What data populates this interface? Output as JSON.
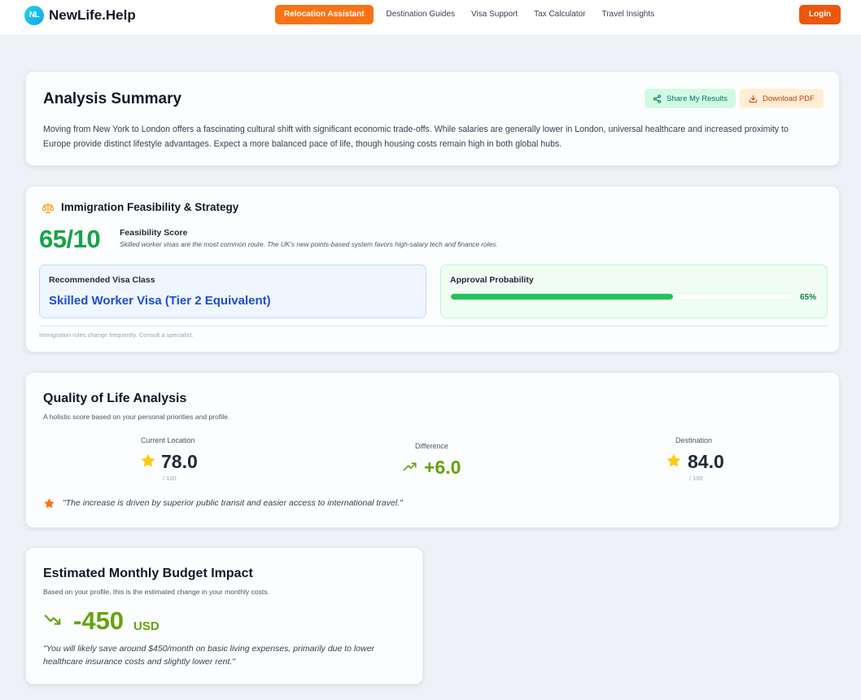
{
  "header": {
    "logo_badge": "NL",
    "brand": "NewLife.Help",
    "nav": [
      {
        "label": "Relocation Assistant",
        "active": true
      },
      {
        "label": "Destination Guides",
        "active": false
      },
      {
        "label": "Visa Support",
        "active": false
      },
      {
        "label": "Tax Calculator",
        "active": false
      },
      {
        "label": "Travel Insights",
        "active": false
      }
    ],
    "login_label": "Login"
  },
  "summary": {
    "title": "Analysis Summary",
    "share_label": "Share My Results",
    "download_label": "Download PDF",
    "text": "Moving from New York to London offers a fascinating cultural shift with significant economic trade-offs. While salaries are generally lower in London, universal healthcare and increased proximity to Europe provide distinct lifestyle advantages. Expect a more balanced pace of life, though housing costs remain high in both global hubs."
  },
  "immigration": {
    "title": "Immigration Feasibility & Strategy",
    "score": "65/10",
    "score_label": "Feasibility Score",
    "score_note": "Skilled worker visas are the most common route. The UK's new points-based system favors high-salary tech and finance roles.",
    "visa_label": "Recommended Visa Class",
    "visa_name": "Skilled Worker Visa (Tier 2 Equivalent)",
    "approval_label": "Approval Probability",
    "approval_fraction": 0.65,
    "approval_text": "65%",
    "disclaimer": "Immigration rules change frequently. Consult a specialist."
  },
  "qol": {
    "title": "Quality of Life Analysis",
    "subtitle": "A holistic score based on your personal priorities and profile.",
    "current_label": "Current Location",
    "current_value": "78.0",
    "current_max": "/ 100",
    "diff_label": "Difference",
    "diff_value": "+6.0",
    "dest_label": "Destination",
    "dest_value": "84.0",
    "dest_max": "/ 100",
    "note": "\"The increase is driven by superior public transit and easier access to international travel.\""
  },
  "budget": {
    "title": "Estimated Monthly Budget Impact",
    "subtitle": "Based on your profile, this is the estimated change in your monthly costs.",
    "amount": "-450",
    "currency": "USD",
    "note": "\"You will likely save around $450/month on basic living expenses, primarily due to lower healthcare insurance costs and slightly lower rent.\""
  },
  "colors": {
    "accent": "#f97316",
    "login": "#ea580c",
    "success": "#16a34a",
    "visa_blue": "#1d4ed8",
    "positive_green": "#65a30d"
  },
  "icons": [
    "share-icon",
    "download-icon",
    "scales-icon",
    "star-icon",
    "trending-up-icon",
    "trending-down-icon"
  ]
}
